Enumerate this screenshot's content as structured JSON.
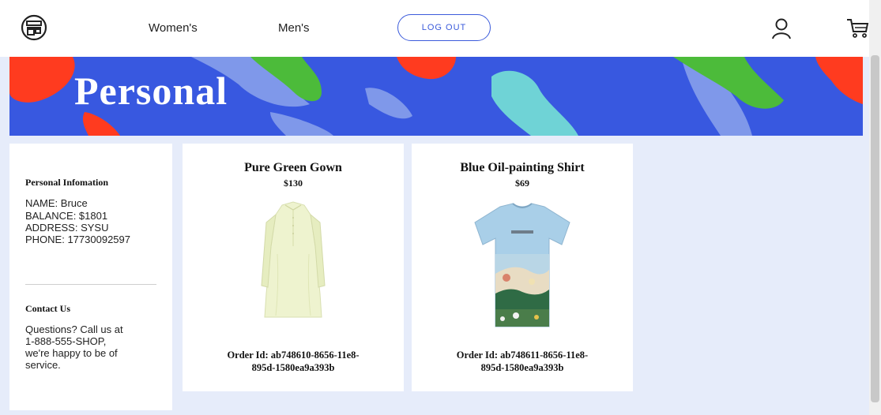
{
  "header": {
    "nav": {
      "women": "Women's",
      "men": "Men's"
    },
    "logout_label": "LOG OUT",
    "logo_icon": "store-icon",
    "user_icon": "user-icon",
    "cart_icon": "cart-icon"
  },
  "banner": {
    "title": "Personal"
  },
  "personal_info": {
    "heading": "Personal Infomation",
    "name": "NAME: Bruce",
    "balance": "BALANCE: $1801",
    "address": "ADDRESS: SYSU",
    "phone": "PHONE: 17730092597"
  },
  "contact": {
    "heading": "Contact Us",
    "line1": "Questions? Call us at",
    "line2": "1-888-555-SHOP,",
    "line3": "we're happy to be of",
    "line4": "service."
  },
  "orders": [
    {
      "title": "Pure Green Gown",
      "price": "$130",
      "order_line1": "Order Id: ab748610-8656-11e8-",
      "order_line2": "895d-1580ea9a393b"
    },
    {
      "title": "Blue Oil-painting Shirt",
      "price": "$69",
      "order_line1": "Order Id: ab748611-8656-11e8-",
      "order_line2": "895d-1580ea9a393b"
    }
  ],
  "colors": {
    "accent": "#3b5bdb",
    "banner_blue": "#3858e0",
    "banner_red": "#ff3b1f",
    "banner_green": "#4cbb3a",
    "banner_cyan": "#6fd3d6",
    "page_bg": "#e6ecfa"
  }
}
